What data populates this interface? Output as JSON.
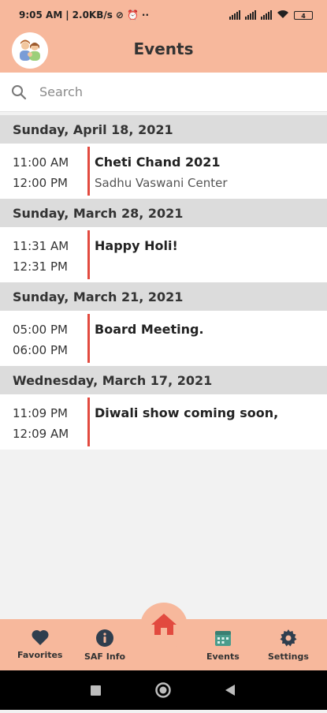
{
  "status": {
    "time": "9:05 AM",
    "netspeed": "2.0KB/s",
    "battery": "4"
  },
  "header": {
    "title": "Events"
  },
  "search": {
    "placeholder": "Search"
  },
  "days": [
    {
      "date": "Sunday, April 18, 2021",
      "event": {
        "start": "11:00 AM",
        "end": "12:00 PM",
        "title": "Cheti Chand 2021",
        "location": "Sadhu Vaswani Center"
      }
    },
    {
      "date": "Sunday, March 28, 2021",
      "event": {
        "start": "11:31 AM",
        "end": "12:31 PM",
        "title": "Happy Holi!",
        "location": ""
      }
    },
    {
      "date": "Sunday, March 21, 2021",
      "event": {
        "start": "05:00 PM",
        "end": "06:00 PM",
        "title": "Board Meeting.",
        "location": ""
      }
    },
    {
      "date": "Wednesday, March 17, 2021",
      "event": {
        "start": "11:09 PM",
        "end": "12:09 AM",
        "title": "Diwali show coming soon,",
        "location": ""
      }
    }
  ],
  "nav": {
    "favorites": "Favorites",
    "saf_info": "SAF Info",
    "events": "Events",
    "settings": "Settings"
  },
  "colors": {
    "accent": "#f7b89c",
    "event_bar": "#e24a3f",
    "home": "#e24a3f",
    "events_icon": "#4a9c8c"
  }
}
